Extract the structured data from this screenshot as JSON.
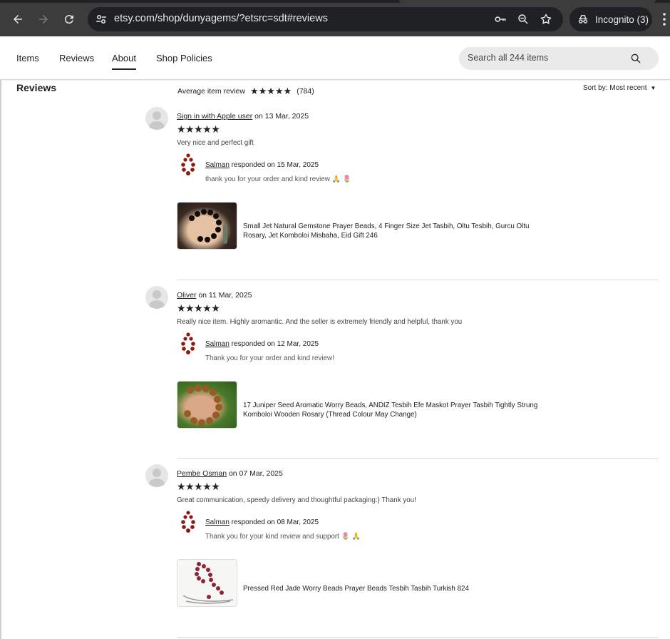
{
  "browser": {
    "url": "etsy.com/shop/dunyagems/?etsrc=sdt#reviews",
    "incognito_label": "Incognito (3)"
  },
  "shopnav": {
    "tabs": [
      {
        "label": "Items"
      },
      {
        "label": "Reviews"
      },
      {
        "label": "About"
      },
      {
        "label": "Shop Policies"
      }
    ],
    "active_tab": "About",
    "search_placeholder": "Search all 244 items"
  },
  "reviews_section": {
    "heading": "Reviews",
    "average_label": "Average item review",
    "average_stars": "★★★★★",
    "review_count": "(784)",
    "sort_label": "Sort by: Most recent"
  },
  "reviews": [
    {
      "user": "Sign in with Apple user",
      "date_text": " on 13 Mar, 2025",
      "stars": "★★★★★",
      "text": "Very nice and perfect gift",
      "response_user": "Salman",
      "response_date": " responded on 15 Mar, 2025",
      "response_text": "thank you for your order and kind review 🙏 🌷",
      "item_line1": "Small Jet Natural Gemstone Prayer Beads, 4 Finger Size Jet Tasbih, Oltu Tesbih, Gurcu Oltu",
      "item_line2": "Rosary, Jet Komboloi Misbaha, Eid Gift 246"
    },
    {
      "user": "Oliver",
      "date_text": " on 11 Mar, 2025",
      "stars": "★★★★★",
      "text": "Really nice item. Highly aromantic. And the seller is extremely friendly and helpful, thank you",
      "response_user": "Salman",
      "response_date": " responded on 12 Mar, 2025",
      "response_text": "Thank you for your order and kind review!",
      "item_line1": "17 Juniper Seed Aromatic Worry Beads, ANDIZ Tesbih Efe Maskot Prayer Tasbih Tightly Strung",
      "item_line2": "Komboloi Wooden Rosary (Thread Colour May Change)"
    },
    {
      "user": "Pembe Osman",
      "date_text": " on 07 Mar, 2025",
      "stars": "★★★★★",
      "text": "Great communication, speedy delivery and thoughtful packaging:) Thank you!",
      "response_user": "Salman",
      "response_date": " responded on 08 Mar, 2025",
      "response_text": "Thank you for your kind review and support 🌷 🙏",
      "item_line1": "Pressed Red Jade Worry Beads Prayer Beads Tesbih Tasbih Turkish 824",
      "item_line2": ""
    }
  ],
  "colors": {
    "chrome_bg": "#3c3c3c",
    "omnibox_bg": "#202124",
    "bead_red": "#8b1a10"
  }
}
